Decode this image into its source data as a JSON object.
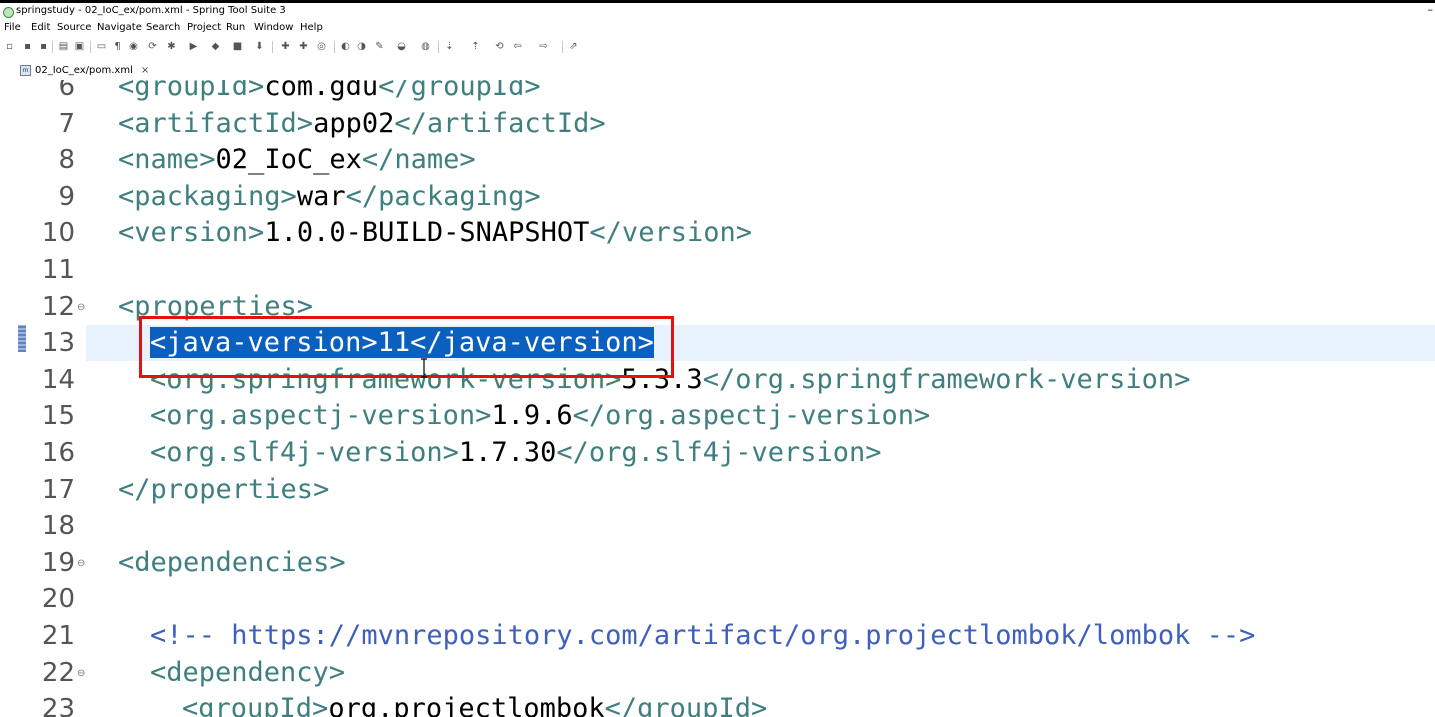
{
  "window": {
    "title": "springstudy - 02_IoC_ex/pom.xml - Spring Tool Suite 3",
    "minimize": "–"
  },
  "menu": [
    "File",
    "Edit",
    "Source",
    "Navigate",
    "Search",
    "Project",
    "Run",
    "Window",
    "Help"
  ],
  "tab": {
    "label": "02_IoC_ex/pom.xml",
    "close": "×"
  },
  "lines": [
    {
      "n": "6",
      "segs": [
        [
          "t",
          "<groupId>"
        ],
        [
          "x",
          "com.gdu"
        ],
        [
          "t",
          "</groupId>"
        ]
      ]
    },
    {
      "n": "7",
      "segs": [
        [
          "t",
          "<artifactId>"
        ],
        [
          "x",
          "app02"
        ],
        [
          "t",
          "</artifactId>"
        ]
      ]
    },
    {
      "n": "8",
      "segs": [
        [
          "t",
          "<name>"
        ],
        [
          "x",
          "02_IoC_ex"
        ],
        [
          "t",
          "</name>"
        ]
      ]
    },
    {
      "n": "9",
      "segs": [
        [
          "t",
          "<packaging>"
        ],
        [
          "x",
          "war"
        ],
        [
          "t",
          "</packaging>"
        ]
      ]
    },
    {
      "n": "10",
      "segs": [
        [
          "t",
          "<version>"
        ],
        [
          "x",
          "1.0.0-BUILD-SNAPSHOT"
        ],
        [
          "t",
          "</version>"
        ]
      ]
    },
    {
      "n": "11",
      "segs": []
    },
    {
      "n": "12",
      "fold": true,
      "segs": [
        [
          "t",
          "<properties>"
        ]
      ]
    },
    {
      "n": "13",
      "indent": 1,
      "current": true,
      "segs": [
        [
          "s",
          "<java-version>11</java-version>"
        ]
      ]
    },
    {
      "n": "14",
      "indent": 1,
      "segs": [
        [
          "t",
          "<org.springframework-version>"
        ],
        [
          "x",
          "5.3.3"
        ],
        [
          "t",
          "</org.springframework-version>"
        ]
      ]
    },
    {
      "n": "15",
      "indent": 1,
      "segs": [
        [
          "t",
          "<org.aspectj-version>"
        ],
        [
          "x",
          "1.9.6"
        ],
        [
          "t",
          "</org.aspectj-version>"
        ]
      ]
    },
    {
      "n": "16",
      "indent": 1,
      "segs": [
        [
          "t",
          "<org.slf4j-version>"
        ],
        [
          "x",
          "1.7.30"
        ],
        [
          "t",
          "</org.slf4j-version>"
        ]
      ]
    },
    {
      "n": "17",
      "segs": [
        [
          "t",
          "</properties>"
        ]
      ]
    },
    {
      "n": "18",
      "segs": []
    },
    {
      "n": "19",
      "fold": true,
      "segs": [
        [
          "t",
          "<dependencies>"
        ]
      ]
    },
    {
      "n": "20",
      "segs": []
    },
    {
      "n": "21",
      "indent": 1,
      "segs": [
        [
          "c",
          "<!-- https://mvnrepository.com/artifact/org.projectlombok/lombok -->"
        ]
      ]
    },
    {
      "n": "22",
      "indent": 1,
      "fold": true,
      "segs": [
        [
          "t",
          "<dependency>"
        ]
      ]
    },
    {
      "n": "23",
      "indent": 2,
      "segs": [
        [
          "t",
          "<groupId>"
        ],
        [
          "x",
          "org.projectlombok"
        ],
        [
          "t",
          "</groupId>"
        ]
      ]
    }
  ],
  "colors": {
    "tag": "#3f7f7f",
    "comment": "#3f5fbf",
    "selection": "#0a5fbf",
    "current_line": "#e8f2fe",
    "highlight_box": "#e21212"
  }
}
